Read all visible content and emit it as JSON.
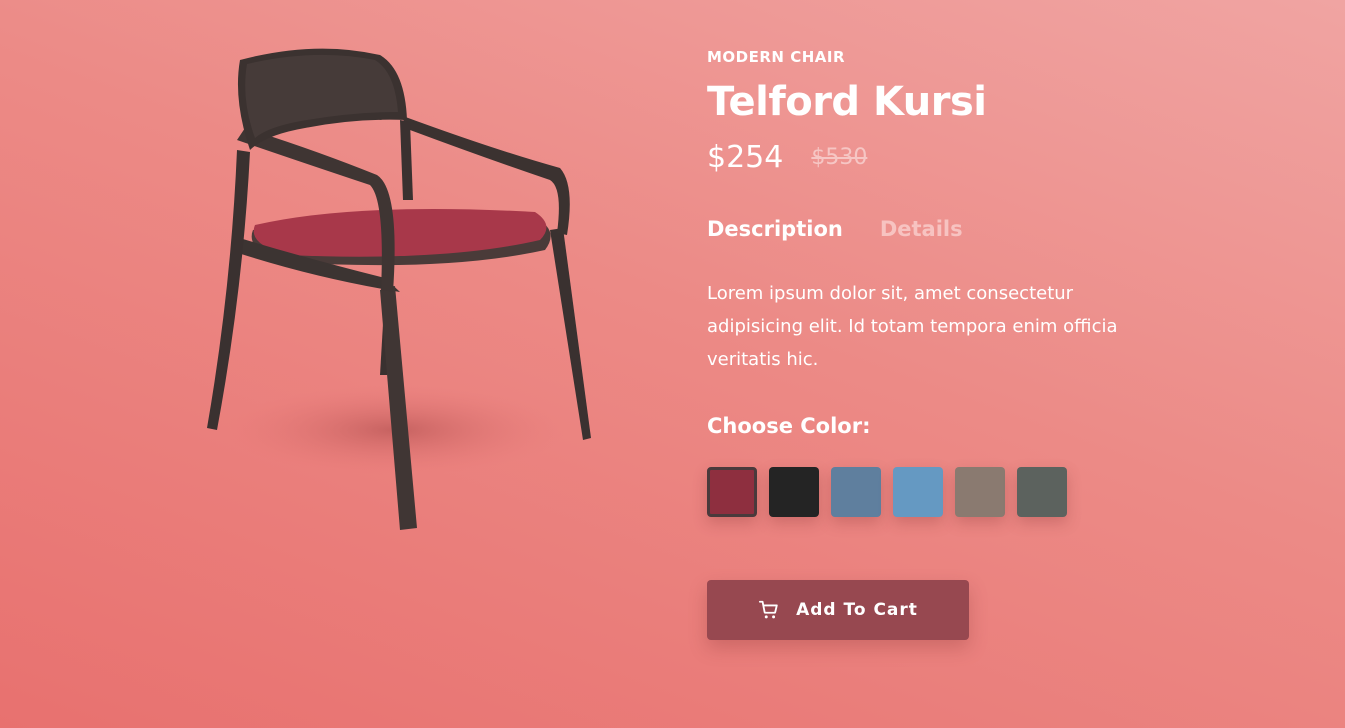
{
  "product": {
    "category": "MODERN CHAIR",
    "title": "Telford Kursi",
    "price": "$254",
    "old_price": "$530",
    "image_icon": "chair-image"
  },
  "tabs": [
    {
      "label": "Description",
      "active": true
    },
    {
      "label": "Details",
      "active": false
    }
  ],
  "description": "Lorem ipsum dolor sit, amet consectetur adipisicing elit. Id totam tempora enim officia veritatis hic.",
  "color_picker": {
    "label": "Choose Color:",
    "swatches": [
      {
        "color": "#8e2f3f",
        "selected": true
      },
      {
        "color": "#242424",
        "selected": false
      },
      {
        "color": "#5f7f9e",
        "selected": false
      },
      {
        "color": "#6599c2",
        "selected": false
      },
      {
        "color": "#8a7a70",
        "selected": false
      },
      {
        "color": "#5c625e",
        "selected": false
      }
    ]
  },
  "cart_button": {
    "label": "Add To Cart",
    "icon": "cart-icon"
  },
  "colors": {
    "background_top": "#f0a4a2",
    "background_bottom": "#e8716f",
    "button": "#974850",
    "inactive_tab": "#f7c3c1"
  }
}
